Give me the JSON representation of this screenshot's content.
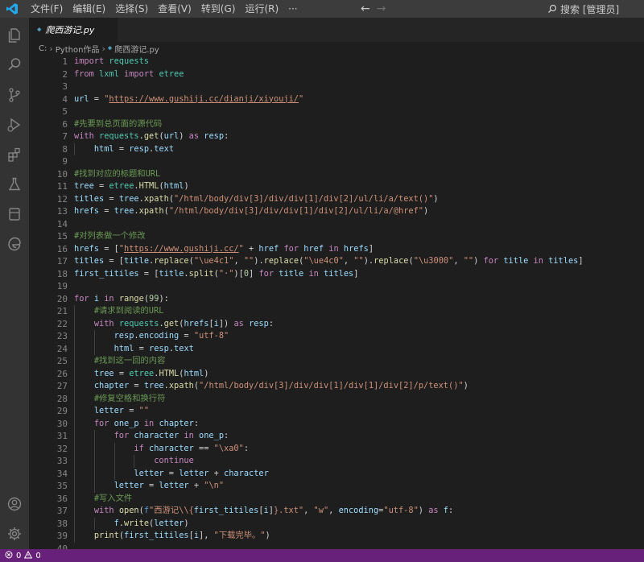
{
  "titlebar": {
    "menus": [
      "文件(F)",
      "编辑(E)",
      "选择(S)",
      "查看(V)",
      "转到(G)",
      "运行(R)",
      "···"
    ],
    "search_label": "搜索 [管理员]"
  },
  "tab": {
    "label": "爬西游记.py"
  },
  "breadcrumb": {
    "items": [
      "C:",
      "Python作品",
      "爬西游记.py"
    ]
  },
  "editor": {
    "line_numbers": [
      "1",
      "2",
      "3",
      "4",
      "5",
      "6",
      "7",
      "8",
      "9",
      "10",
      "11",
      "12",
      "13",
      "14",
      "15",
      "16",
      "17",
      "18",
      "19",
      "20",
      "21",
      "22",
      "23",
      "24",
      "25",
      "26",
      "27",
      "28",
      "29",
      "30",
      "31",
      "32",
      "33",
      "34",
      "35",
      "36",
      "37",
      "38",
      "39",
      "40"
    ],
    "lines": [
      [
        {
          "c": "kw-ctl",
          "t": "import"
        },
        {
          "c": "",
          "t": " "
        },
        {
          "c": "cls",
          "t": "requests"
        }
      ],
      [
        {
          "c": "kw-ctl",
          "t": "from"
        },
        {
          "c": "",
          "t": " "
        },
        {
          "c": "cls",
          "t": "lxml"
        },
        {
          "c": "",
          "t": " "
        },
        {
          "c": "kw-ctl",
          "t": "import"
        },
        {
          "c": "",
          "t": " "
        },
        {
          "c": "cls",
          "t": "etree"
        }
      ],
      [],
      [
        {
          "c": "var",
          "t": "url"
        },
        {
          "c": "",
          "t": " = "
        },
        {
          "c": "str",
          "t": "\""
        },
        {
          "c": "url",
          "t": "https://www.gushiji.cc/dianji/xiyouji/"
        },
        {
          "c": "str",
          "t": "\""
        }
      ],
      [],
      [
        {
          "c": "cm",
          "t": "#先要到总页面的源代码"
        }
      ],
      [
        {
          "c": "kw-ctl",
          "t": "with"
        },
        {
          "c": "",
          "t": " "
        },
        {
          "c": "cls",
          "t": "requests"
        },
        {
          "c": "",
          "t": "."
        },
        {
          "c": "fn",
          "t": "get"
        },
        {
          "c": "",
          "t": "("
        },
        {
          "c": "var",
          "t": "url"
        },
        {
          "c": "",
          "t": ") "
        },
        {
          "c": "kw-ctl",
          "t": "as"
        },
        {
          "c": "",
          "t": " "
        },
        {
          "c": "var",
          "t": "resp"
        },
        {
          "c": "",
          "t": ":"
        }
      ],
      [
        {
          "c": "",
          "t": "    "
        },
        {
          "c": "var",
          "t": "html"
        },
        {
          "c": "",
          "t": " = "
        },
        {
          "c": "var",
          "t": "resp"
        },
        {
          "c": "",
          "t": "."
        },
        {
          "c": "var",
          "t": "text"
        }
      ],
      [],
      [
        {
          "c": "cm",
          "t": "#找到对应的标题和URL"
        }
      ],
      [
        {
          "c": "var",
          "t": "tree"
        },
        {
          "c": "",
          "t": " = "
        },
        {
          "c": "cls",
          "t": "etree"
        },
        {
          "c": "",
          "t": "."
        },
        {
          "c": "fn",
          "t": "HTML"
        },
        {
          "c": "",
          "t": "("
        },
        {
          "c": "var",
          "t": "html"
        },
        {
          "c": "",
          "t": ")"
        }
      ],
      [
        {
          "c": "var",
          "t": "titles"
        },
        {
          "c": "",
          "t": " = "
        },
        {
          "c": "var",
          "t": "tree"
        },
        {
          "c": "",
          "t": "."
        },
        {
          "c": "fn",
          "t": "xpath"
        },
        {
          "c": "",
          "t": "("
        },
        {
          "c": "str",
          "t": "\"/html/body/div[3]/div/div[1]/div[2]/ul/li/a/text()\""
        },
        {
          "c": "",
          "t": ")"
        }
      ],
      [
        {
          "c": "var",
          "t": "hrefs"
        },
        {
          "c": "",
          "t": " = "
        },
        {
          "c": "var",
          "t": "tree"
        },
        {
          "c": "",
          "t": "."
        },
        {
          "c": "fn",
          "t": "xpath"
        },
        {
          "c": "",
          "t": "("
        },
        {
          "c": "str",
          "t": "\"/html/body/div[3]/div/div[1]/div[2]/ul/li/a/@href\""
        },
        {
          "c": "",
          "t": ")"
        }
      ],
      [],
      [
        {
          "c": "cm",
          "t": "#对列表做一个修改"
        }
      ],
      [
        {
          "c": "var",
          "t": "hrefs"
        },
        {
          "c": "",
          "t": " = ["
        },
        {
          "c": "str",
          "t": "\""
        },
        {
          "c": "url",
          "t": "https://www.gushiji.cc/"
        },
        {
          "c": "str",
          "t": "\""
        },
        {
          "c": "",
          "t": " + "
        },
        {
          "c": "var",
          "t": "href"
        },
        {
          "c": "",
          "t": " "
        },
        {
          "c": "kw-ctl",
          "t": "for"
        },
        {
          "c": "",
          "t": " "
        },
        {
          "c": "var",
          "t": "href"
        },
        {
          "c": "",
          "t": " "
        },
        {
          "c": "kw-ctl",
          "t": "in"
        },
        {
          "c": "",
          "t": " "
        },
        {
          "c": "var",
          "t": "hrefs"
        },
        {
          "c": "",
          "t": "]"
        }
      ],
      [
        {
          "c": "var",
          "t": "titles"
        },
        {
          "c": "",
          "t": " = ["
        },
        {
          "c": "var",
          "t": "title"
        },
        {
          "c": "",
          "t": "."
        },
        {
          "c": "fn",
          "t": "replace"
        },
        {
          "c": "",
          "t": "("
        },
        {
          "c": "str",
          "t": "\"\\ue4c1\""
        },
        {
          "c": "",
          "t": ", "
        },
        {
          "c": "str",
          "t": "\"\""
        },
        {
          "c": "",
          "t": ")."
        },
        {
          "c": "fn",
          "t": "replace"
        },
        {
          "c": "",
          "t": "("
        },
        {
          "c": "str",
          "t": "\"\\ue4c0\""
        },
        {
          "c": "",
          "t": ", "
        },
        {
          "c": "str",
          "t": "\"\""
        },
        {
          "c": "",
          "t": ")."
        },
        {
          "c": "fn",
          "t": "replace"
        },
        {
          "c": "",
          "t": "("
        },
        {
          "c": "str",
          "t": "\"\\u3000\""
        },
        {
          "c": "",
          "t": ", "
        },
        {
          "c": "str",
          "t": "\"\""
        },
        {
          "c": "",
          "t": ") "
        },
        {
          "c": "kw-ctl",
          "t": "for"
        },
        {
          "c": "",
          "t": " "
        },
        {
          "c": "var",
          "t": "title"
        },
        {
          "c": "",
          "t": " "
        },
        {
          "c": "kw-ctl",
          "t": "in"
        },
        {
          "c": "",
          "t": " "
        },
        {
          "c": "var",
          "t": "titles"
        },
        {
          "c": "",
          "t": "]"
        }
      ],
      [
        {
          "c": "var",
          "t": "first_titiles"
        },
        {
          "c": "",
          "t": " = ["
        },
        {
          "c": "var",
          "t": "title"
        },
        {
          "c": "",
          "t": "."
        },
        {
          "c": "fn",
          "t": "split"
        },
        {
          "c": "",
          "t": "("
        },
        {
          "c": "str",
          "t": "\"·\""
        },
        {
          "c": "",
          "t": ")["
        },
        {
          "c": "num",
          "t": "0"
        },
        {
          "c": "",
          "t": "] "
        },
        {
          "c": "kw-ctl",
          "t": "for"
        },
        {
          "c": "",
          "t": " "
        },
        {
          "c": "var",
          "t": "title"
        },
        {
          "c": "",
          "t": " "
        },
        {
          "c": "kw-ctl",
          "t": "in"
        },
        {
          "c": "",
          "t": " "
        },
        {
          "c": "var",
          "t": "titles"
        },
        {
          "c": "",
          "t": "]"
        }
      ],
      [],
      [
        {
          "c": "kw-ctl",
          "t": "for"
        },
        {
          "c": "",
          "t": " "
        },
        {
          "c": "var",
          "t": "i"
        },
        {
          "c": "",
          "t": " "
        },
        {
          "c": "kw-ctl",
          "t": "in"
        },
        {
          "c": "",
          "t": " "
        },
        {
          "c": "fn",
          "t": "range"
        },
        {
          "c": "",
          "t": "("
        },
        {
          "c": "num",
          "t": "99"
        },
        {
          "c": "",
          "t": "):"
        }
      ],
      [
        {
          "c": "",
          "t": "    "
        },
        {
          "c": "cm",
          "t": "#请求到阅读的URL"
        }
      ],
      [
        {
          "c": "",
          "t": "    "
        },
        {
          "c": "kw-ctl",
          "t": "with"
        },
        {
          "c": "",
          "t": " "
        },
        {
          "c": "cls",
          "t": "requests"
        },
        {
          "c": "",
          "t": "."
        },
        {
          "c": "fn",
          "t": "get"
        },
        {
          "c": "",
          "t": "("
        },
        {
          "c": "var",
          "t": "hrefs"
        },
        {
          "c": "",
          "t": "["
        },
        {
          "c": "var",
          "t": "i"
        },
        {
          "c": "",
          "t": "]) "
        },
        {
          "c": "kw-ctl",
          "t": "as"
        },
        {
          "c": "",
          "t": " "
        },
        {
          "c": "var",
          "t": "resp"
        },
        {
          "c": "",
          "t": ":"
        }
      ],
      [
        {
          "c": "",
          "t": "        "
        },
        {
          "c": "var",
          "t": "resp"
        },
        {
          "c": "",
          "t": "."
        },
        {
          "c": "var",
          "t": "encoding"
        },
        {
          "c": "",
          "t": " = "
        },
        {
          "c": "str",
          "t": "\"utf-8\""
        }
      ],
      [
        {
          "c": "",
          "t": "        "
        },
        {
          "c": "var",
          "t": "html"
        },
        {
          "c": "",
          "t": " = "
        },
        {
          "c": "var",
          "t": "resp"
        },
        {
          "c": "",
          "t": "."
        },
        {
          "c": "var",
          "t": "text"
        }
      ],
      [
        {
          "c": "",
          "t": "    "
        },
        {
          "c": "cm",
          "t": "#找到这一回的内容"
        }
      ],
      [
        {
          "c": "",
          "t": "    "
        },
        {
          "c": "var",
          "t": "tree"
        },
        {
          "c": "",
          "t": " = "
        },
        {
          "c": "cls",
          "t": "etree"
        },
        {
          "c": "",
          "t": "."
        },
        {
          "c": "fn",
          "t": "HTML"
        },
        {
          "c": "",
          "t": "("
        },
        {
          "c": "var",
          "t": "html"
        },
        {
          "c": "",
          "t": ")"
        }
      ],
      [
        {
          "c": "",
          "t": "    "
        },
        {
          "c": "var",
          "t": "chapter"
        },
        {
          "c": "",
          "t": " = "
        },
        {
          "c": "var",
          "t": "tree"
        },
        {
          "c": "",
          "t": "."
        },
        {
          "c": "fn",
          "t": "xpath"
        },
        {
          "c": "",
          "t": "("
        },
        {
          "c": "str",
          "t": "\"/html/body/div[3]/div/div[1]/div[1]/div[2]/p/text()\""
        },
        {
          "c": "",
          "t": ")"
        }
      ],
      [
        {
          "c": "",
          "t": "    "
        },
        {
          "c": "cm",
          "t": "#修复空格和换行符"
        }
      ],
      [
        {
          "c": "",
          "t": "    "
        },
        {
          "c": "var",
          "t": "letter"
        },
        {
          "c": "",
          "t": " = "
        },
        {
          "c": "str",
          "t": "\"\""
        }
      ],
      [
        {
          "c": "",
          "t": "    "
        },
        {
          "c": "kw-ctl",
          "t": "for"
        },
        {
          "c": "",
          "t": " "
        },
        {
          "c": "var",
          "t": "one_p"
        },
        {
          "c": "",
          "t": " "
        },
        {
          "c": "kw-ctl",
          "t": "in"
        },
        {
          "c": "",
          "t": " "
        },
        {
          "c": "var",
          "t": "chapter"
        },
        {
          "c": "",
          "t": ":"
        }
      ],
      [
        {
          "c": "",
          "t": "        "
        },
        {
          "c": "kw-ctl",
          "t": "for"
        },
        {
          "c": "",
          "t": " "
        },
        {
          "c": "var",
          "t": "character"
        },
        {
          "c": "",
          "t": " "
        },
        {
          "c": "kw-ctl",
          "t": "in"
        },
        {
          "c": "",
          "t": " "
        },
        {
          "c": "var",
          "t": "one_p"
        },
        {
          "c": "",
          "t": ":"
        }
      ],
      [
        {
          "c": "",
          "t": "            "
        },
        {
          "c": "kw-ctl",
          "t": "if"
        },
        {
          "c": "",
          "t": " "
        },
        {
          "c": "var",
          "t": "character"
        },
        {
          "c": "",
          "t": " == "
        },
        {
          "c": "str",
          "t": "\"\\xa0\""
        },
        {
          "c": "",
          "t": ":"
        }
      ],
      [
        {
          "c": "",
          "t": "                "
        },
        {
          "c": "kw-ctl",
          "t": "continue"
        }
      ],
      [
        {
          "c": "",
          "t": "            "
        },
        {
          "c": "var",
          "t": "letter"
        },
        {
          "c": "",
          "t": " = "
        },
        {
          "c": "var",
          "t": "letter"
        },
        {
          "c": "",
          "t": " + "
        },
        {
          "c": "var",
          "t": "character"
        }
      ],
      [
        {
          "c": "",
          "t": "        "
        },
        {
          "c": "var",
          "t": "letter"
        },
        {
          "c": "",
          "t": " = "
        },
        {
          "c": "var",
          "t": "letter"
        },
        {
          "c": "",
          "t": " + "
        },
        {
          "c": "str",
          "t": "\"\\n\""
        }
      ],
      [
        {
          "c": "",
          "t": "    "
        },
        {
          "c": "cm",
          "t": "#写入文件"
        }
      ],
      [
        {
          "c": "",
          "t": "    "
        },
        {
          "c": "kw-ctl",
          "t": "with"
        },
        {
          "c": "",
          "t": " "
        },
        {
          "c": "fn",
          "t": "open"
        },
        {
          "c": "",
          "t": "("
        },
        {
          "c": "kw",
          "t": "f"
        },
        {
          "c": "str",
          "t": "\"西游记\\\\{"
        },
        {
          "c": "var",
          "t": "first_titiles"
        },
        {
          "c": "",
          "t": "["
        },
        {
          "c": "var",
          "t": "i"
        },
        {
          "c": "",
          "t": "]"
        },
        {
          "c": "str",
          "t": "}.txt\""
        },
        {
          "c": "",
          "t": ", "
        },
        {
          "c": "str",
          "t": "\"w\""
        },
        {
          "c": "",
          "t": ", "
        },
        {
          "c": "var",
          "t": "encoding"
        },
        {
          "c": "",
          "t": "="
        },
        {
          "c": "str",
          "t": "\"utf-8\""
        },
        {
          "c": "",
          "t": ") "
        },
        {
          "c": "kw-ctl",
          "t": "as"
        },
        {
          "c": "",
          "t": " "
        },
        {
          "c": "var",
          "t": "f"
        },
        {
          "c": "",
          "t": ":"
        }
      ],
      [
        {
          "c": "",
          "t": "        "
        },
        {
          "c": "var",
          "t": "f"
        },
        {
          "c": "",
          "t": "."
        },
        {
          "c": "fn",
          "t": "write"
        },
        {
          "c": "",
          "t": "("
        },
        {
          "c": "var",
          "t": "letter"
        },
        {
          "c": "",
          "t": ")"
        }
      ],
      [
        {
          "c": "",
          "t": "    "
        },
        {
          "c": "fn",
          "t": "print"
        },
        {
          "c": "",
          "t": "("
        },
        {
          "c": "var",
          "t": "first_titiles"
        },
        {
          "c": "",
          "t": "["
        },
        {
          "c": "var",
          "t": "i"
        },
        {
          "c": "",
          "t": "], "
        },
        {
          "c": "str",
          "t": "\"下载完毕。\""
        },
        {
          "c": "",
          "t": ")"
        }
      ],
      []
    ]
  },
  "statusbar": {
    "errors": "0",
    "warnings": "0"
  },
  "icons": {
    "activity": [
      "explorer-icon",
      "search-icon",
      "source-control-icon",
      "run-debug-icon",
      "extensions-icon",
      "testing-icon",
      "remote-explorer-icon",
      "edge-devtools-icon",
      "account-icon",
      "settings-gear-icon"
    ]
  },
  "colors": {
    "editor_bg": "#1e1e1e",
    "statusbar_bg": "#68217a",
    "titlebar_bg": "#3c3c3c",
    "activitybar_bg": "#333333",
    "vscode_blue": "#23a9f2"
  }
}
